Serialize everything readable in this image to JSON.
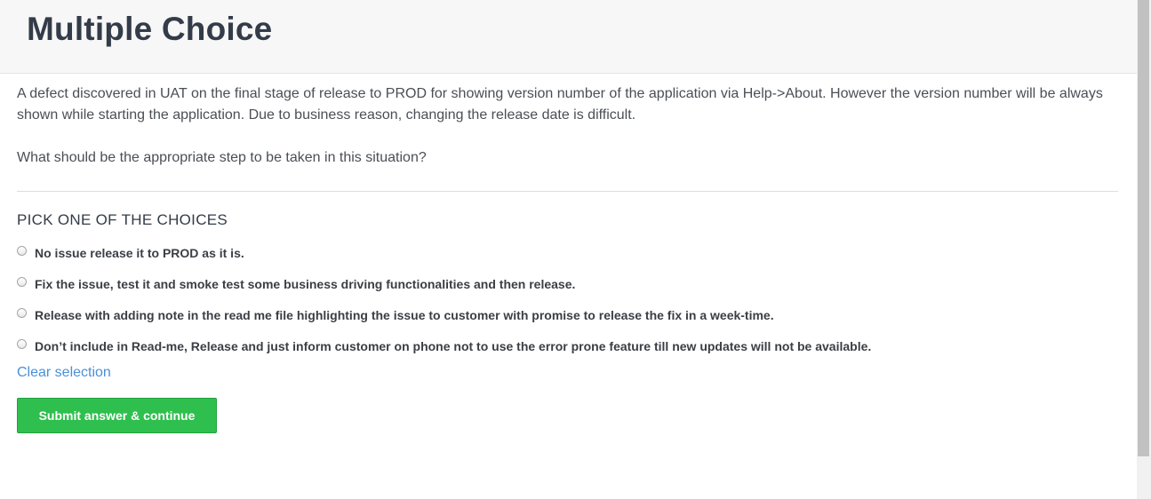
{
  "header": {
    "title": "Multiple Choice"
  },
  "question": {
    "paragraph_1": "A defect discovered in UAT on the final stage of release to PROD for showing version number of the application via Help->About. However the version number will be always shown while starting the application. Due to business reason, changing the release date is difficult.",
    "paragraph_2": "What should be the appropriate step to be taken in this situation?"
  },
  "choices": {
    "heading": "PICK ONE OF THE CHOICES",
    "options": [
      {
        "label": "No issue release it to PROD as it is.",
        "selected": false
      },
      {
        "label": "Fix the issue, test it and smoke test some business driving functionalities and then release.",
        "selected": false
      },
      {
        "label": "Release with adding note in the read me file highlighting the issue to customer with promise to release the fix in a week-time.",
        "selected": false
      },
      {
        "label": "Don’t include in Read-me, Release and just inform customer on phone not to use the error prone feature till new updates will not be available.",
        "selected": false
      }
    ],
    "clear_label": "Clear selection"
  },
  "actions": {
    "submit_label": "Submit answer & continue"
  },
  "colors": {
    "submit_button": "#2fbf4e",
    "link": "#4a90d9",
    "header_background": "#f7f7f7"
  }
}
